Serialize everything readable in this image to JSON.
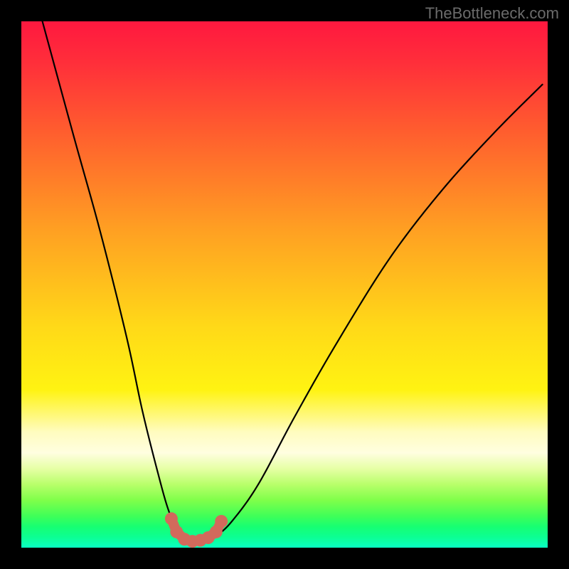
{
  "watermark": "TheBottleneck.com",
  "chart_data": {
    "type": "line",
    "title": "",
    "xlabel": "",
    "ylabel": "",
    "xlim": [
      0,
      100
    ],
    "ylim": [
      0,
      100
    ],
    "series": [
      {
        "name": "bottleneck-curve",
        "x": [
          4,
          10,
          15,
          20,
          23,
          26,
          28,
          30,
          31.5,
          33,
          35,
          37,
          40,
          45,
          52,
          60,
          70,
          80,
          90,
          99
        ],
        "values": [
          100,
          78,
          60,
          40,
          26,
          14,
          7,
          2.5,
          1.2,
          1.0,
          1.2,
          2.2,
          5,
          12,
          25,
          39,
          55,
          68,
          79,
          88
        ]
      }
    ],
    "markers": {
      "name": "highlight-points",
      "color": "#d26a5c",
      "x": [
        28.5,
        29.5,
        31,
        32.5,
        34,
        35.5,
        37,
        38
      ],
      "values": [
        5.5,
        3.0,
        1.6,
        1.2,
        1.4,
        1.9,
        3.0,
        5.0
      ]
    }
  }
}
